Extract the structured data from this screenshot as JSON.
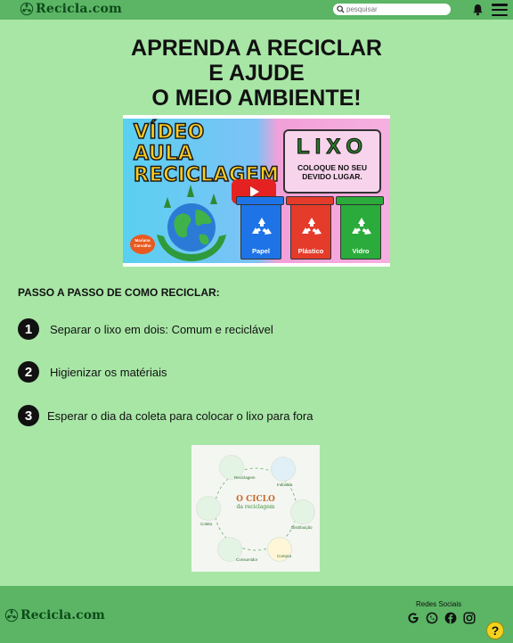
{
  "header": {
    "logo_text": "Recicla.com",
    "search_placeholder": "pesquisar"
  },
  "main": {
    "title_line1": "APRENDA A RECICLAR",
    "title_line2": "E AJUDE",
    "title_line3": "O MEIO AMBIENTE!",
    "video": {
      "title": "VÍDEO AULA RECICLAGEM",
      "lixo_word": "LIXO",
      "lixo_sub": "COLOQUE NO SEU DEVIDO LUGAR.",
      "bins": [
        "Papel",
        "Plástico",
        "Vidro"
      ],
      "badge": "Mariana Carvalho"
    },
    "steps_heading": "PASSO A PASSO DE COMO RECICLAR:",
    "steps": [
      {
        "number": "1",
        "text": "Separar o lixo em dois: Comum e reciclável"
      },
      {
        "number": "2",
        "text": "Higienizar os matériais"
      },
      {
        "number": "3",
        "text": "Esperar o dia da coleta para colocar o lixo para fora"
      }
    ],
    "cycle": {
      "title": "O CICLO",
      "subtitle": "da reciclagem",
      "labels": [
        "Reciclagem",
        "Indústria",
        "Distribuição",
        "Compra",
        "Consumidor",
        "Coleta"
      ]
    }
  },
  "footer": {
    "logo_text": "Recicla.com",
    "social_title": "Redes Sociais",
    "social_icons": [
      "google-icon",
      "whatsapp-icon",
      "facebook-icon",
      "instagram-icon"
    ]
  },
  "help_label": "?",
  "colors": {
    "background": "#a8e6a6",
    "header": "#5bb565",
    "logo": "#0e4a1a",
    "help": "#f3d21e"
  }
}
